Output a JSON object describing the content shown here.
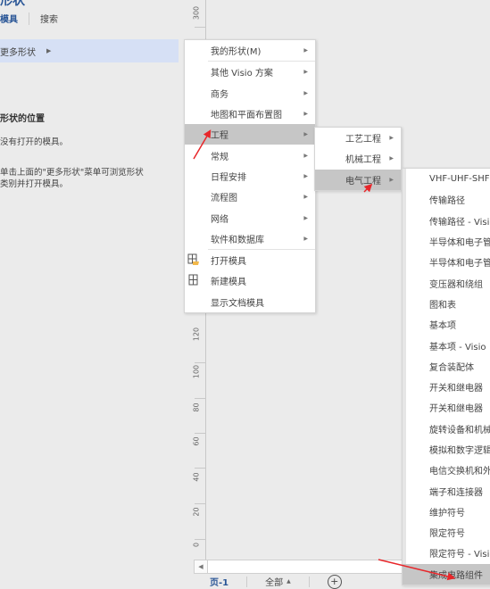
{
  "shapes_pane": {
    "title": "形状",
    "tabs": [
      {
        "label": "模具",
        "active": true
      },
      {
        "label": "搜索",
        "active": false
      }
    ],
    "more_shapes": {
      "label": "更多形状"
    },
    "info": {
      "title": "形状的位置",
      "line1": "没有打开的模具。",
      "line2": "单击上面的\"更多形状\"菜单可浏览形状",
      "line3": "类别并打开模具。"
    }
  },
  "ruler": {
    "ticks": [
      "300",
      "120",
      "100",
      "80",
      "60",
      "40",
      "20",
      "0"
    ]
  },
  "menu_level1": {
    "items": [
      {
        "label": "我的形状(M)",
        "submenu": true
      },
      {
        "label": "其他 Visio 方案",
        "submenu": true
      },
      {
        "label": "商务",
        "submenu": true
      },
      {
        "label": "地图和平面布置图",
        "submenu": true
      },
      {
        "label": "工程",
        "submenu": true,
        "highlighted": true
      },
      {
        "label": "常规",
        "submenu": true
      },
      {
        "label": "日程安排",
        "submenu": true
      },
      {
        "label": "流程图",
        "submenu": true
      },
      {
        "label": "网络",
        "submenu": true
      },
      {
        "label": "软件和数据库",
        "submenu": true
      },
      {
        "label": "打开模具",
        "icon": "open-stencil-icon"
      },
      {
        "label": "新建模具",
        "icon": "new-stencil-icon"
      },
      {
        "label": "显示文档模具"
      }
    ]
  },
  "menu_level2": {
    "items": [
      {
        "label": "工艺工程",
        "submenu": true
      },
      {
        "label": "机械工程",
        "submenu": true
      },
      {
        "label": "电气工程",
        "submenu": true,
        "highlighted": true
      }
    ]
  },
  "menu_level3": {
    "items": [
      {
        "label": "VHF-UHF-SHF"
      },
      {
        "label": "传输路径"
      },
      {
        "label": "传输路径 - Visio"
      },
      {
        "label": "半导体和电子管"
      },
      {
        "label": "半导体和电子管"
      },
      {
        "label": "变压器和绕组"
      },
      {
        "label": "图和表"
      },
      {
        "label": "基本项"
      },
      {
        "label": "基本项 - Visio"
      },
      {
        "label": "复合装配体"
      },
      {
        "label": "开关和继电器"
      },
      {
        "label": "开关和继电器"
      },
      {
        "label": "旋转设备和机械"
      },
      {
        "label": "模拟和数字逻辑"
      },
      {
        "label": "电信交换机和外围设备"
      },
      {
        "label": "端子和连接器"
      },
      {
        "label": "维护符号"
      },
      {
        "label": "限定符号"
      },
      {
        "label": "限定符号 - Visio"
      },
      {
        "label": "集成电路组件",
        "highlighted": true
      }
    ]
  },
  "statusbar": {
    "page_tab": "页-1",
    "all_pages": "全部",
    "add_page": "+"
  },
  "colors": {
    "accent": "#2b5797",
    "highlight": "#c6c6c6",
    "more_shapes_bg": "#d6e0f5",
    "annotation": "#e8262a"
  }
}
